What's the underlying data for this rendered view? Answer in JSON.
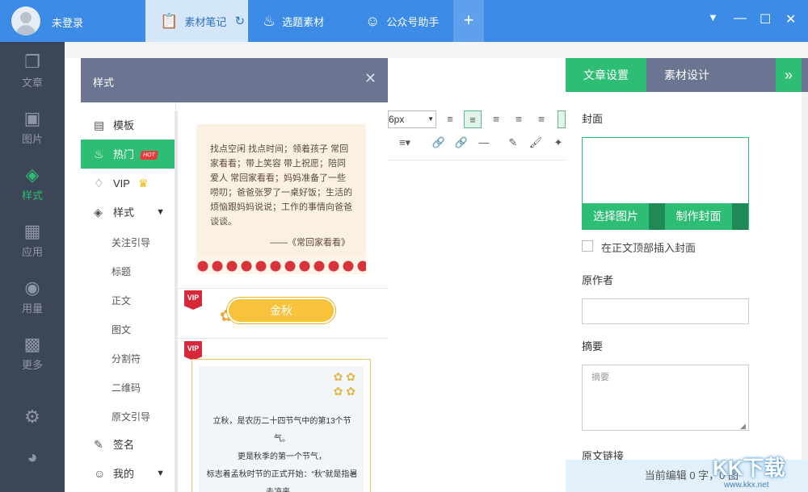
{
  "topbar": {
    "user_label": "未登录",
    "tabs": [
      {
        "label": "素材笔记",
        "icon": "notebook-icon"
      },
      {
        "label": "选题素材",
        "icon": "flame-icon"
      },
      {
        "label": "公众号助手",
        "icon": "users-icon"
      }
    ],
    "add_tab": "+",
    "window": {
      "menu": "▼",
      "minimize": "—",
      "maximize": "☐",
      "close": "✕"
    }
  },
  "leftnav": {
    "items": [
      {
        "label": "文章",
        "icon": "article-icon"
      },
      {
        "label": "图片",
        "icon": "image-icon"
      },
      {
        "label": "样式",
        "icon": "layers-icon"
      },
      {
        "label": "应用",
        "icon": "box-icon"
      },
      {
        "label": "用量",
        "icon": "ai-icon"
      },
      {
        "label": "更多",
        "icon": "grid-icon"
      }
    ],
    "active": "样式"
  },
  "style_panel": {
    "title": "样式",
    "menu": [
      {
        "label": "模板",
        "icon": "template-icon"
      },
      {
        "label": "热门",
        "badge": "HOT",
        "icon": "fire-icon"
      },
      {
        "label": "VIP",
        "icon": "diamond-icon"
      },
      {
        "label": "样式",
        "icon": "layers-icon"
      },
      {
        "label": "签名",
        "icon": "pen-icon"
      },
      {
        "label": "我的",
        "icon": "user-icon"
      }
    ],
    "submenu": [
      "关注引导",
      "标题",
      "正文",
      "图文",
      "分割符",
      "二维码",
      "原文引导"
    ],
    "cards": {
      "poem": "找点空闲 找点时间；领着孩子 常回家看看；带上笑容 带上祝愿；陪同爱人 常回家看看；妈妈准备了一些唠叨；爸爸张罗了一桌好饭；生活的烦恼跟妈妈说说；工作的事情向爸爸谈谈。",
      "poem_source": "——《常回家看看》",
      "vip_badge": "VIP",
      "title_pill": "金秋",
      "autumn_lines": [
        "立秋，是农历二十四节气中的第13个节气。",
        "更是秋季的第一个节气，",
        "标志着孟秋时节的正式开始：“秋”就是指暑去凉来。"
      ]
    }
  },
  "editor": {
    "font_size": "6px"
  },
  "right_panel": {
    "tab_article": "文章设置",
    "tab_material": "素材设计",
    "expand": "»",
    "cover_label": "封面",
    "select_image": "选择图片",
    "make_cover": "制作封面",
    "insert_cover": "在正文顶部插入封面",
    "author_label": "原作者",
    "summary_label": "摘要",
    "summary_placeholder": "摘要",
    "link_label": "原文链接",
    "status": "当前编辑 0 字，0 图"
  },
  "watermark": {
    "big": "KK下载",
    "small": "www.kkx.net"
  },
  "colors": {
    "topbar": "#3c8ce7",
    "accent": "#2ebd74",
    "nav": "#3d4656",
    "panel_header": "#6b7490"
  }
}
